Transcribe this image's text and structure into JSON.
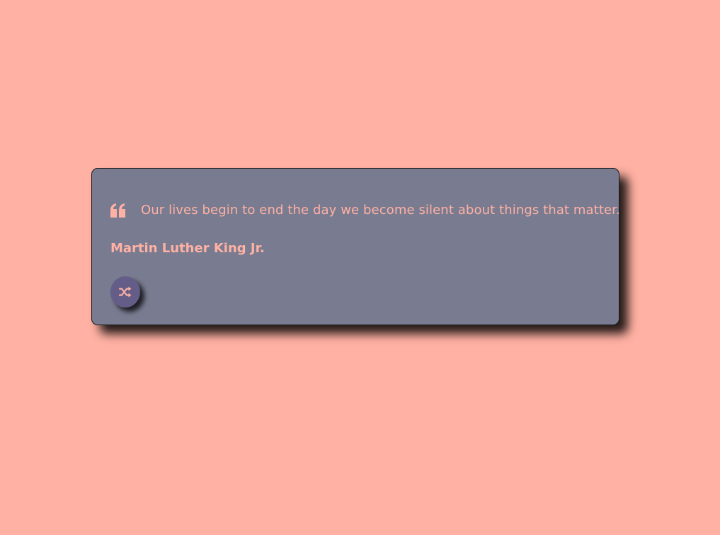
{
  "quote": {
    "text": "Our lives begin to end the day we become silent about things that matter.",
    "author": "Martin Luther King Jr."
  },
  "icons": {
    "quote": "quote-left-icon",
    "shuffle": "shuffle-icon"
  },
  "colors": {
    "background": "#ffb1a3",
    "card": "#797b90",
    "text": "#ffb1a3",
    "button": "#635d87"
  }
}
